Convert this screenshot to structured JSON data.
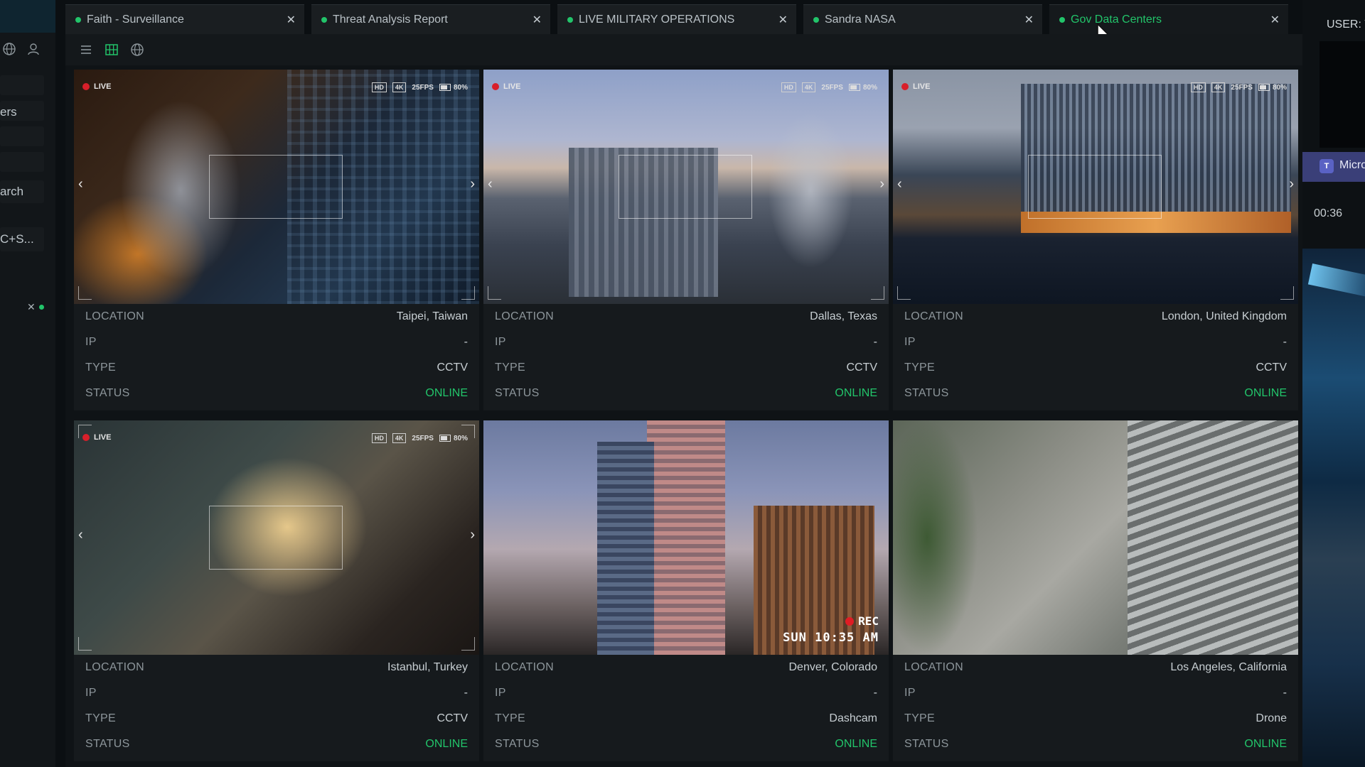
{
  "left_rail": {
    "items": [
      {
        "label": "ers"
      },
      {
        "label": "arch"
      },
      {
        "label": "C+S..."
      }
    ]
  },
  "tabs": [
    {
      "label": "Faith - Surveillance",
      "active": false
    },
    {
      "label": "Threat Analysis Report",
      "active": false
    },
    {
      "label": "LIVE MILITARY OPERATIONS",
      "active": false
    },
    {
      "label": "Sandra NASA",
      "active": false
    },
    {
      "label": "Gov Data Centers",
      "active": true
    }
  ],
  "toolbar": {
    "icons": [
      "list-view-icon",
      "grid-view-icon",
      "globe-view-icon"
    ]
  },
  "feeds": [
    {
      "overlay": {
        "live": "LIVE",
        "hd": "HD",
        "res": "4K",
        "fps": "25FPS",
        "battery": "80%",
        "battery_level": 0.8
      },
      "info": {
        "location_label": "LOCATION",
        "location": "Taipei, Taiwan",
        "ip_label": "IP",
        "ip": "-",
        "type_label": "TYPE",
        "type": "CCTV",
        "status_label": "STATUS",
        "status": "ONLINE"
      }
    },
    {
      "overlay": {
        "live": "LIVE",
        "hd": "HD",
        "res": "4K",
        "fps": "25FPS",
        "battery": "80%",
        "battery_level": 0.8
      },
      "info": {
        "location_label": "LOCATION",
        "location": "Dallas, Texas",
        "ip_label": "IP",
        "ip": "-",
        "type_label": "TYPE",
        "type": "CCTV",
        "status_label": "STATUS",
        "status": "ONLINE"
      }
    },
    {
      "overlay": {
        "live": "LIVE",
        "hd": "HD",
        "res": "4K",
        "fps": "25FPS",
        "battery": "80%",
        "battery_level": 0.8
      },
      "info": {
        "location_label": "LOCATION",
        "location": "London, United Kingdom",
        "ip_label": "IP",
        "ip": "-",
        "type_label": "TYPE",
        "type": "CCTV",
        "status_label": "STATUS",
        "status": "ONLINE"
      }
    },
    {
      "overlay": {
        "live": "LIVE",
        "hd": "HD",
        "res": "4K",
        "fps": "25FPS",
        "battery": "80%",
        "battery_level": 0.8
      },
      "info": {
        "location_label": "LOCATION",
        "location": "Istanbul, Turkey",
        "ip_label": "IP",
        "ip": "-",
        "type_label": "TYPE",
        "type": "CCTV",
        "status_label": "STATUS",
        "status": "ONLINE"
      }
    },
    {
      "overlay": {
        "rec": "REC",
        "timestamp": "SUN 10:35 AM"
      },
      "info": {
        "location_label": "LOCATION",
        "location": "Denver, Colorado",
        "ip_label": "IP",
        "ip": "-",
        "type_label": "TYPE",
        "type": "Dashcam",
        "status_label": "STATUS",
        "status": "ONLINE"
      }
    },
    {
      "overlay": {},
      "info": {
        "location_label": "LOCATION",
        "location": "Los Angeles, California",
        "ip_label": "IP",
        "ip": "-",
        "type_label": "TYPE",
        "type": "Drone",
        "status_label": "STATUS",
        "status": "ONLINE"
      }
    }
  ],
  "right_panel": {
    "user_label": "USER: V",
    "teams_label": "Micro",
    "teams_icon": "T",
    "timer": "00:36"
  },
  "colors": {
    "accent_green": "#22c46a",
    "rec_red": "#d81f2a",
    "background": "#0b0f12"
  }
}
